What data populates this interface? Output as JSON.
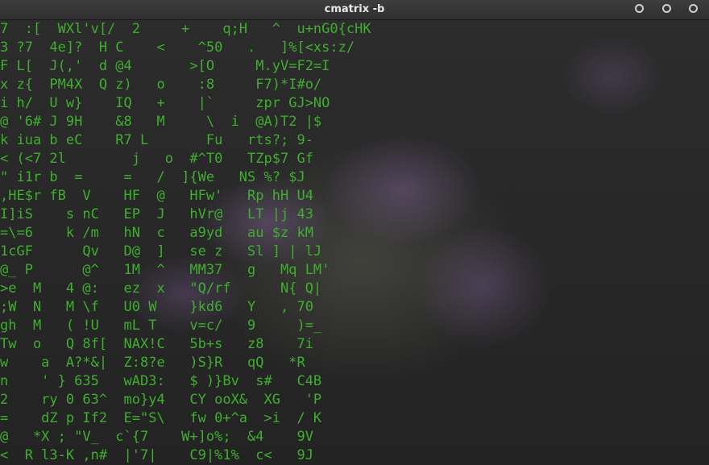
{
  "window": {
    "title": "cmatrix -b"
  },
  "terminal": {
    "lines": [
      "7  :[  WXl'v[/  2     +    q;H   ^  u+nG0{cHK",
      "3 ?7  4e]?  H C    <    ^50   .   ]%[<xs:z/",
      "F L[  J(,'  d @4       >[O     M.yV=F2=I",
      "x z{  PM4X  Q z)   o    :8     F7)*I#o/",
      "i h/  U w}    IQ   +    |`     zpr GJ>NO",
      "@ '6# J 9H    &8   M     \\  i  @A)T2 |$",
      "k iua b eC    R7 L       Fu   rts?; 9-",
      "< (<7 2l        j   o  #^T0   TZp$7 Gf",
      "\" i1r b  =     =   /  ]{We   NS %? $J",
      ",HE$r fB  V    HF  @   HFw'   Rp hH U4",
      "I]iS    s nC   EP  J   hVr@   LT |j 43",
      "=\\=6    k /m   hN  c   a9yd   au $z kM",
      "1cGF      Qv   D@  ]   se z   Sl ] | lJ",
      "@_ P      @^   1M  ^   MM37   g   Mq LM'",
      ">e  M   4 @:   ez  x   \"Q/rf      N{ Q|",
      ";W  N   M \\f   U0 W    }kd6   Y   , 70",
      "gh  M   ( !U   mL T    v=c/   9     )=_",
      "Tw  o   Q 8f[  NAX!C   5b+s   z8    7i",
      "w    a  A?*&|  Z:8?e   )S}R   qQ   *R",
      "n    ' } 635   wAD3:   $ )}Bv  s#   C4B",
      "2    ry 0 63^  mo}y4   CY ooX&  XG   'P",
      "=    dZ p If2  E=\"S\\   fw 0+^a  >i  / K",
      "@   *X ; \"V_  c`{7    W+]o%;  &4    9V",
      "<  R l3-K ,n#  |'7|    C9|%1%  c<   9J"
    ]
  }
}
